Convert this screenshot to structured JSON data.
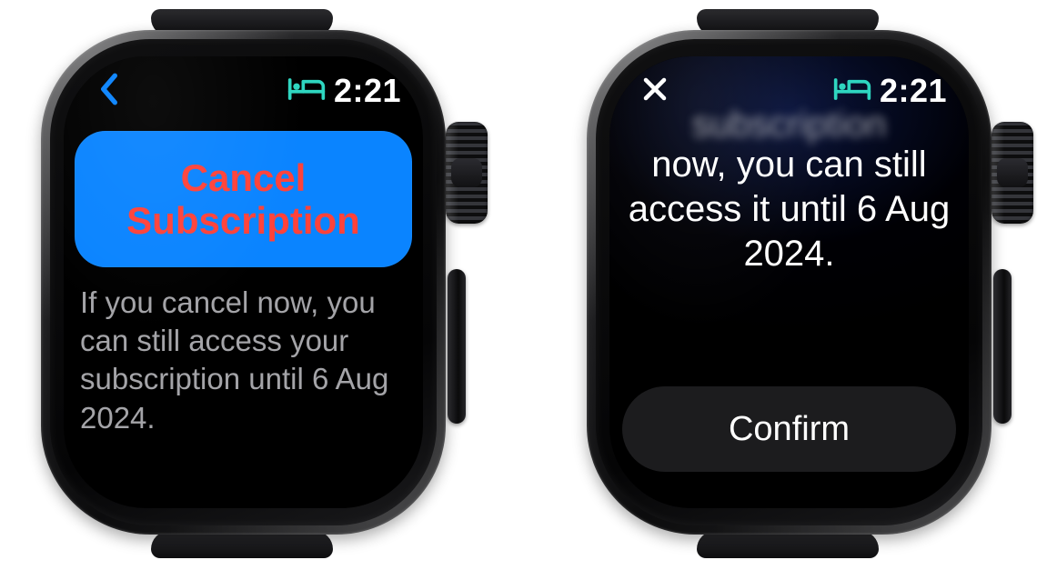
{
  "status": {
    "time": "2:21",
    "sleep_icon": "bed-icon"
  },
  "screen1": {
    "cancel_button_label": "Cancel\nSubscription",
    "description": "If you cancel now, you can still access your subscription until 6 Aug 2024."
  },
  "screen2": {
    "blurred_line": "subscription",
    "body_text": "now, you can still access it until 6 Aug 2024.",
    "confirm_label": "Confirm"
  }
}
